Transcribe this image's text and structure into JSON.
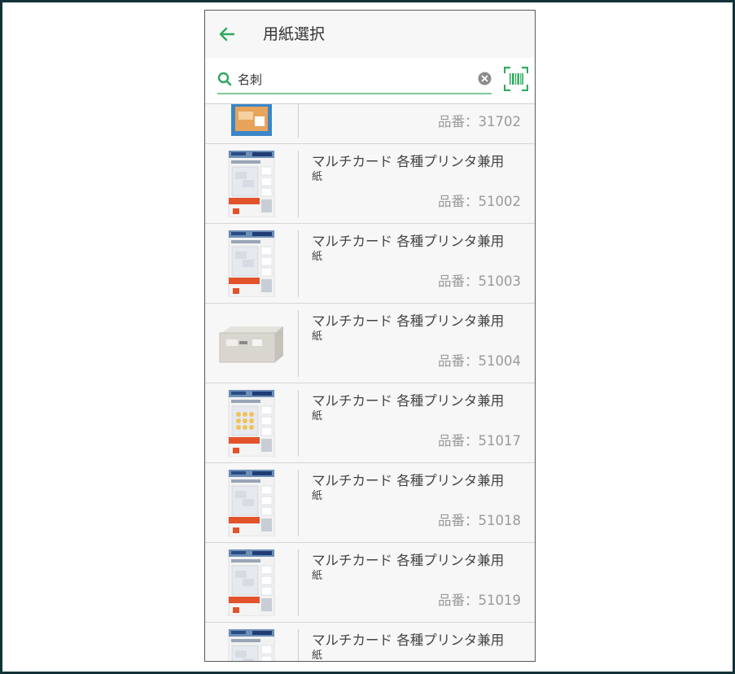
{
  "header": {
    "title": "用紙選択"
  },
  "search": {
    "value": "名刺",
    "placeholder": ""
  },
  "colors": {
    "accent": "#2eaa5c",
    "underline": "#7fc79a",
    "frame": "#123238"
  },
  "items": [
    {
      "name": "",
      "name2": "",
      "code": "品番：31702",
      "thumb": "blue-pack"
    },
    {
      "name": "マルチカード 各種プリンタ兼用",
      "name2": "紙",
      "code": "品番：51002",
      "thumb": "aone-pack"
    },
    {
      "name": "マルチカード 各種プリンタ兼用",
      "name2": "紙",
      "code": "品番：51003",
      "thumb": "aone-pack"
    },
    {
      "name": "マルチカード 各種プリンタ兼用",
      "name2": "紙",
      "code": "品番：51004",
      "thumb": "box"
    },
    {
      "name": "マルチカード 各種プリンタ兼用",
      "name2": "紙",
      "code": "品番：51017",
      "thumb": "aone-pack-dots"
    },
    {
      "name": "マルチカード 各種プリンタ兼用",
      "name2": "紙",
      "code": "品番：51018",
      "thumb": "aone-pack"
    },
    {
      "name": "マルチカード 各種プリンタ兼用",
      "name2": "紙",
      "code": "品番：51019",
      "thumb": "aone-pack"
    },
    {
      "name": "マルチカード 各種プリンタ兼用",
      "name2": "紙",
      "code": "",
      "thumb": "aone-pack"
    }
  ]
}
